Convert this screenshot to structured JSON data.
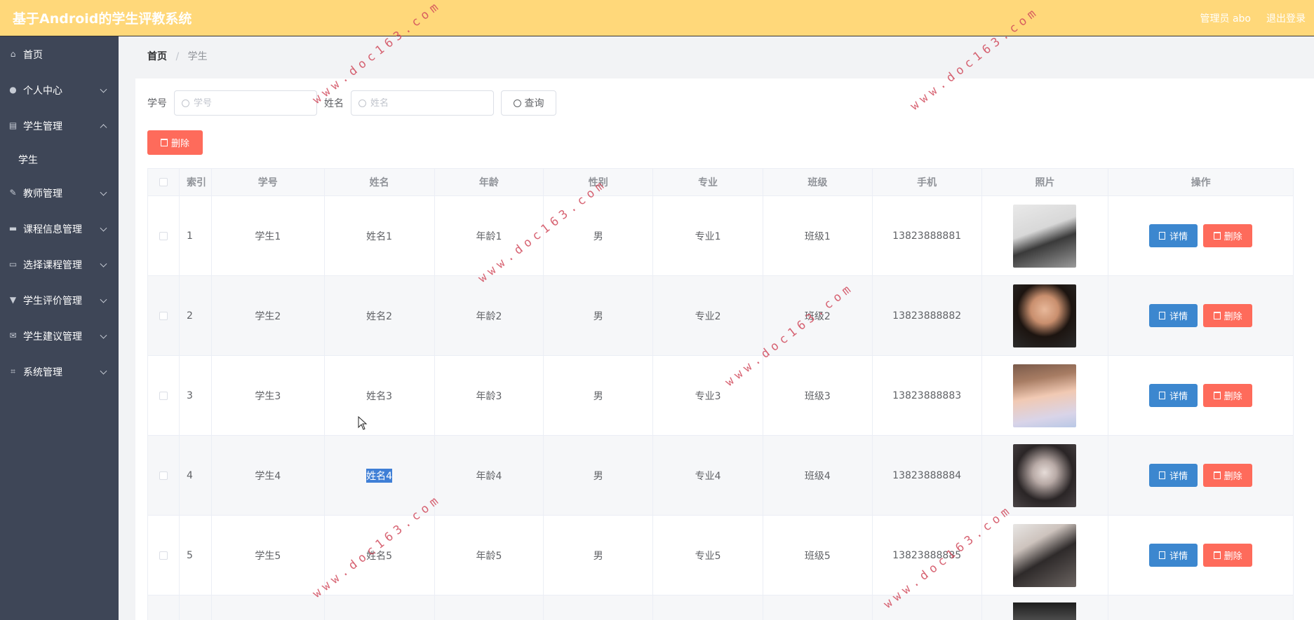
{
  "header": {
    "title": "基于Android的学生评教系统",
    "user": "管理员 abo",
    "logout": "退出登录"
  },
  "sidebar": {
    "items": [
      {
        "label": "首页",
        "icon": "home-icon",
        "expanded": false,
        "has_children": false
      },
      {
        "label": "个人中心",
        "icon": "user-icon",
        "has_children": true
      },
      {
        "label": "学生管理",
        "icon": "clipboard-icon",
        "has_children": true,
        "expanded": true
      },
      {
        "label": "教师管理",
        "icon": "pen-icon",
        "has_children": true
      },
      {
        "label": "课程信息管理",
        "icon": "ticket-icon",
        "has_children": true
      },
      {
        "label": "选择课程管理",
        "icon": "card-icon",
        "has_children": true
      },
      {
        "label": "学生评价管理",
        "icon": "trophy-icon",
        "has_children": true
      },
      {
        "label": "学生建议管理",
        "icon": "mail-icon",
        "has_children": true
      },
      {
        "label": "系统管理",
        "icon": "crop-icon",
        "has_children": true
      }
    ],
    "sub_student": "学生"
  },
  "breadcrumb": {
    "home": "首页",
    "separator": "/",
    "current": "学生"
  },
  "search": {
    "student_no_label": "学号",
    "student_no_placeholder": "学号",
    "name_label": "姓名",
    "name_placeholder": "姓名",
    "query_button": "查询"
  },
  "actions": {
    "delete_button": "删除"
  },
  "table": {
    "headers": [
      "索引",
      "学号",
      "姓名",
      "年龄",
      "性别",
      "专业",
      "班级",
      "手机",
      "照片",
      "操作"
    ],
    "rows": [
      {
        "index": "1",
        "student_no": "学生1",
        "name": "姓名1",
        "age": "年龄1",
        "gender": "男",
        "major": "专业1",
        "class": "班级1",
        "phone": "13823888881"
      },
      {
        "index": "2",
        "student_no": "学生2",
        "name": "姓名2",
        "age": "年龄2",
        "gender": "男",
        "major": "专业2",
        "class": "班级2",
        "phone": "13823888882"
      },
      {
        "index": "3",
        "student_no": "学生3",
        "name": "姓名3",
        "age": "年龄3",
        "gender": "男",
        "major": "专业3",
        "class": "班级3",
        "phone": "13823888883"
      },
      {
        "index": "4",
        "student_no": "学生4",
        "name": "姓名4",
        "age": "年龄4",
        "gender": "男",
        "major": "专业4",
        "class": "班级4",
        "phone": "13823888884"
      },
      {
        "index": "5",
        "student_no": "学生5",
        "name": "姓名5",
        "age": "年龄5",
        "gender": "男",
        "major": "专业5",
        "class": "班级5",
        "phone": "13823888885"
      }
    ],
    "detail_button": "详情",
    "delete_button": "删除"
  },
  "watermark": "www.doc163.com",
  "colors": {
    "header_bg": "#ffd87a",
    "sidebar_bg": "#3e4657",
    "danger": "#fe6b5b",
    "primary": "#3c87cf"
  }
}
